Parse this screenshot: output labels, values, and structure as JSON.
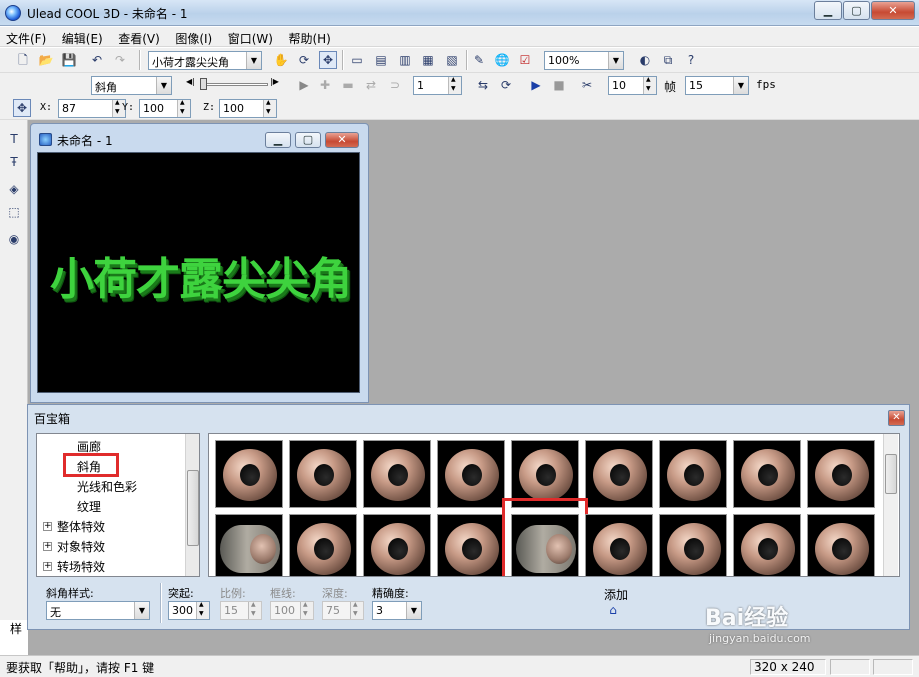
{
  "window": {
    "title": "Ulead COOL 3D - 未命名 - 1"
  },
  "menu": [
    "文件(F)",
    "编辑(E)",
    "查看(V)",
    "图像(I)",
    "窗口(W)",
    "帮助(H)"
  ],
  "toolbar1": {
    "text_combo": "小荷才露尖尖角",
    "zoom": "100%"
  },
  "toolbar2": {
    "effect_combo": "斜角",
    "frame_value": "1",
    "fps_frames": "10",
    "frames_label": "帧",
    "fps_value": "15",
    "fps_label": "fps"
  },
  "toolbar3": {
    "x_label": "X:",
    "x_value": "87",
    "y_label": "Y:",
    "y_value": "100",
    "z_label": "Z:",
    "z_value": "100"
  },
  "document": {
    "title": "未命名 - 1",
    "canvas_text": "小荷才露尖尖角",
    "text_color": "#3ed33e"
  },
  "easy_palette": {
    "title": "百宝箱",
    "tree": [
      {
        "label": "画廊",
        "expandable": false,
        "indent": 2
      },
      {
        "label": "斜角",
        "expandable": false,
        "indent": 2,
        "highlighted": true
      },
      {
        "label": "光线和色彩",
        "expandable": false,
        "indent": 2
      },
      {
        "label": "纹理",
        "expandable": false,
        "indent": 2
      },
      {
        "label": "整体特效",
        "expandable": true,
        "indent": 0
      },
      {
        "label": "对象特效",
        "expandable": true,
        "indent": 0
      },
      {
        "label": "转场特效",
        "expandable": true,
        "indent": 0
      }
    ],
    "controls": {
      "bevel_style_label": "斜角样式:",
      "bevel_style_value": "无",
      "extrude_label": "突起:",
      "extrude_value": "300",
      "ratio_label": "比例:",
      "ratio_value": "15",
      "border_label": "框线:",
      "border_value": "100",
      "depth_label": "深度:",
      "depth_value": "75",
      "precision_label": "精确度:",
      "precision_value": "3",
      "add_label": "添加"
    },
    "partial_label": "样"
  },
  "status": {
    "hint": "要获取「帮助」，请按 F1 键",
    "size": "320 x 240"
  },
  "watermark": {
    "brand": "Bai经验",
    "site": "jingyan.baidu.com"
  },
  "colors": {
    "highlight": "#e02b2b",
    "workspace": "#ababab"
  }
}
